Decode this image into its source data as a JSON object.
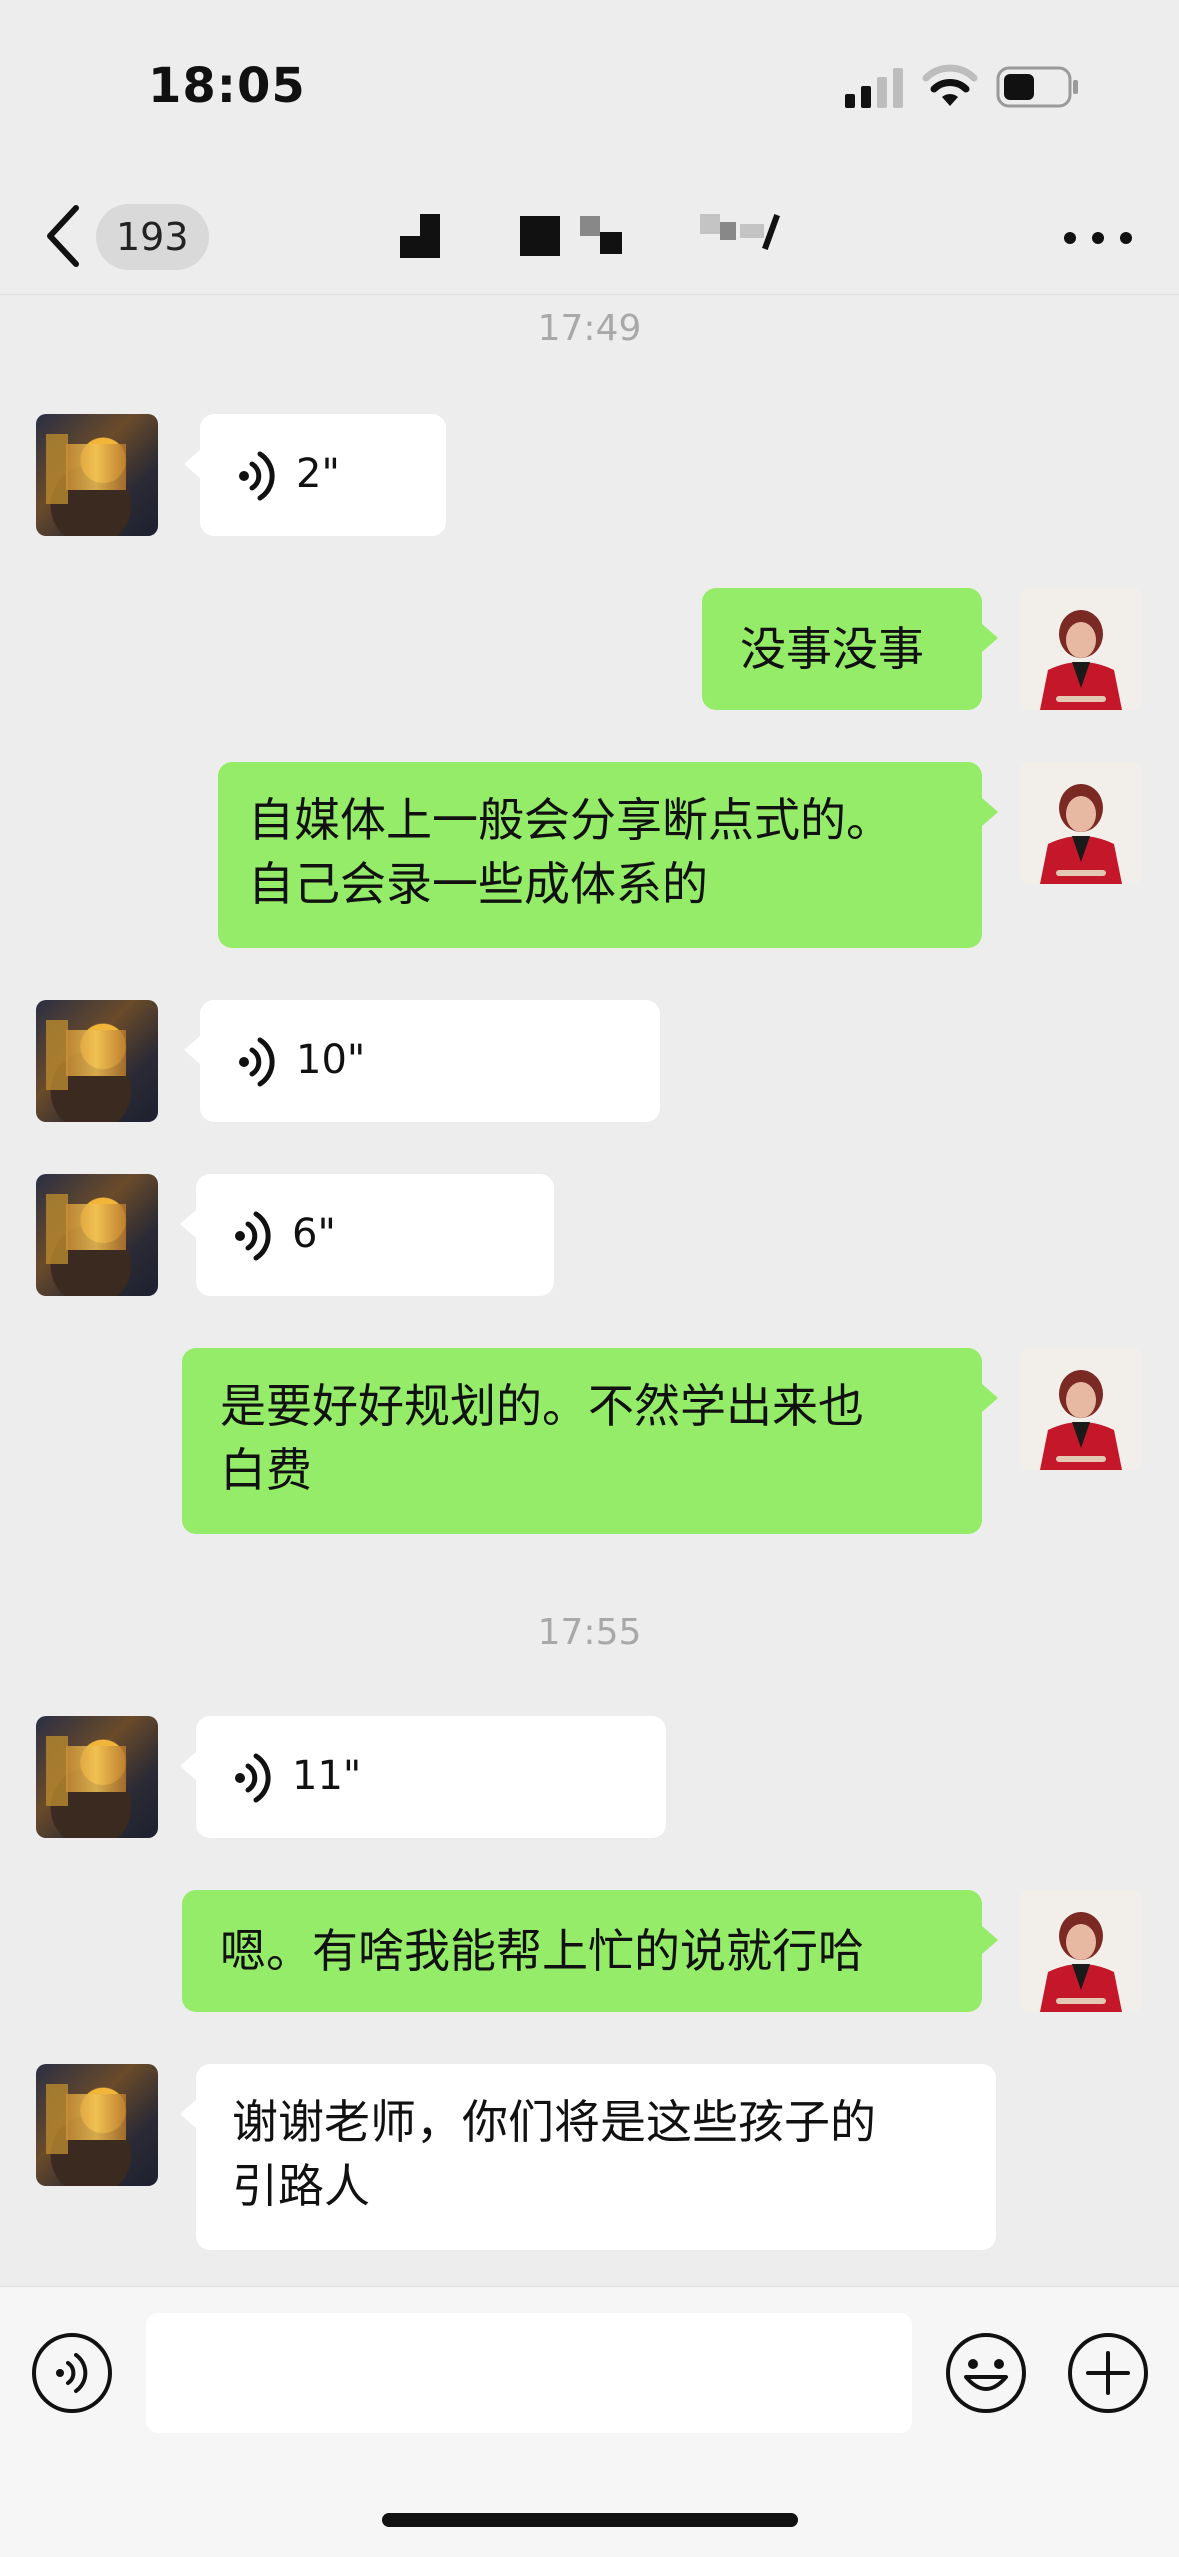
{
  "status_bar": {
    "time": "18:05"
  },
  "nav": {
    "unread_count": "193"
  },
  "chat": {
    "dividers": [
      "17:49",
      "17:55"
    ],
    "messages": [
      {
        "side": "in",
        "type": "voice",
        "duration": "2\""
      },
      {
        "side": "out",
        "type": "text",
        "text": "没事没事"
      },
      {
        "side": "out",
        "type": "text",
        "lines": [
          "自媒体上一般会分享断点式的。",
          "自己会录一些成体系的"
        ]
      },
      {
        "side": "in",
        "type": "voice",
        "duration": "10\""
      },
      {
        "side": "in",
        "type": "voice",
        "duration": "6\""
      },
      {
        "side": "out",
        "type": "text",
        "lines": [
          "是要好好规划的。不然学出来也",
          "白费"
        ]
      },
      {
        "side": "in",
        "type": "voice",
        "duration": "11\""
      },
      {
        "side": "out",
        "type": "text",
        "text": "嗯。有啥我能帮上忙的说就行哈"
      },
      {
        "side": "in",
        "type": "text",
        "lines": [
          "谢谢老师，你们将是这些孩子的",
          "引路人"
        ]
      }
    ]
  },
  "icons": {
    "back": "chevron-left-icon",
    "more": "more-dots-icon",
    "voice": "voice-wave-icon",
    "emoji": "emoji-icon",
    "plus": "plus-icon"
  },
  "colors": {
    "background": "#ededed",
    "outgoing_bubble": "#95ec69",
    "incoming_bubble": "#ffffff",
    "timestamp": "#a8a8a8"
  }
}
